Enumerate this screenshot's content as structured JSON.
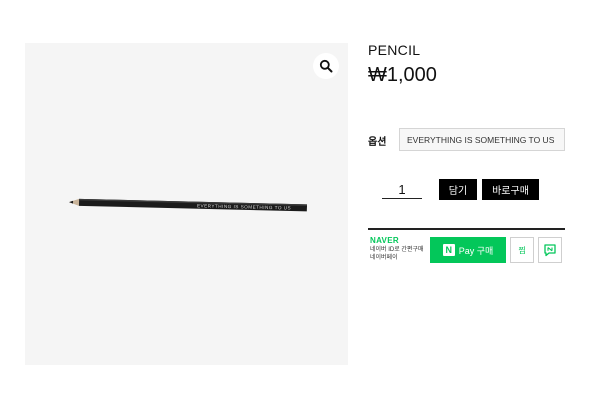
{
  "product": {
    "name": "PENCIL",
    "price": "₩1,000",
    "pencil_print": "EVERYTHING IS SOMETHING TO US",
    "zoom_icon": "magnifier-icon"
  },
  "options": {
    "label": "옵션",
    "selected": "EVERYTHING IS SOMETHING TO US"
  },
  "purchase": {
    "quantity": "1",
    "cart_label": "담기",
    "buy_now_label": "바로구매"
  },
  "naver": {
    "logo": "NAVER",
    "desc_line1": "네이버 ID로 간편구매",
    "desc_line2": "네이버페이",
    "pay_n": "N",
    "pay_label": "Pay 구매",
    "wish_label": "찜",
    "talk_icon": "naver-talk-icon",
    "brand_color": "#03c75a"
  }
}
